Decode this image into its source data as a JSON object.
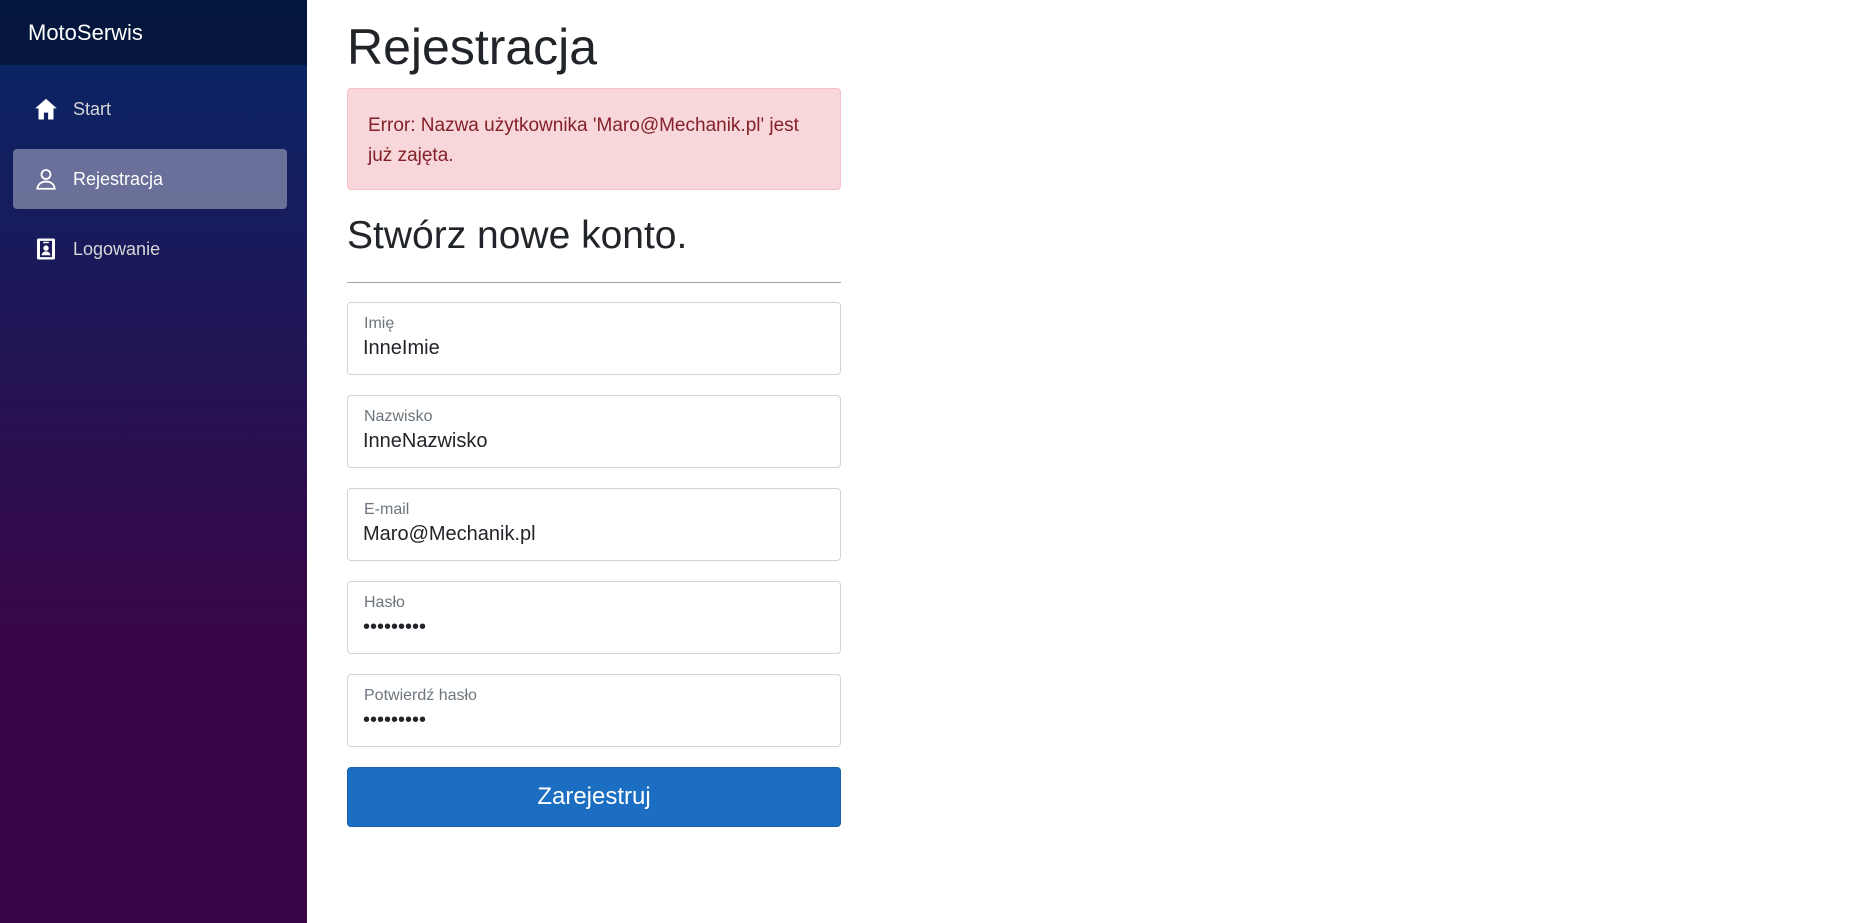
{
  "app": {
    "brand": "MotoSerwis"
  },
  "sidebar": {
    "items": [
      {
        "label": "Start",
        "icon": "home-icon",
        "active": false
      },
      {
        "label": "Rejestracja",
        "icon": "person-icon",
        "active": true
      },
      {
        "label": "Logowanie",
        "icon": "badge-icon",
        "active": false
      }
    ]
  },
  "page": {
    "title": "Rejestracja",
    "error": "Error: Nazwa użytkownika 'Maro@Mechanik.pl' jest już zajęta.",
    "subtitle": "Stwórz nowe konto."
  },
  "form": {
    "first_name": {
      "label": "Imię",
      "value": "InneImie"
    },
    "last_name": {
      "label": "Nazwisko",
      "value": "InneNazwisko"
    },
    "email": {
      "label": "E-mail",
      "value": "Maro@Mechanik.pl"
    },
    "password": {
      "label": "Hasło",
      "value": "123456789"
    },
    "confirm_password": {
      "label": "Potwierdź hasło",
      "value": "123456789"
    },
    "submit_label": "Zarejestruj"
  },
  "colors": {
    "accent": "#1b6ec2",
    "error_bg": "#f8d7da",
    "error_text": "#842029",
    "sidebar_top": "#052767",
    "sidebar_bottom": "#3a0647"
  }
}
